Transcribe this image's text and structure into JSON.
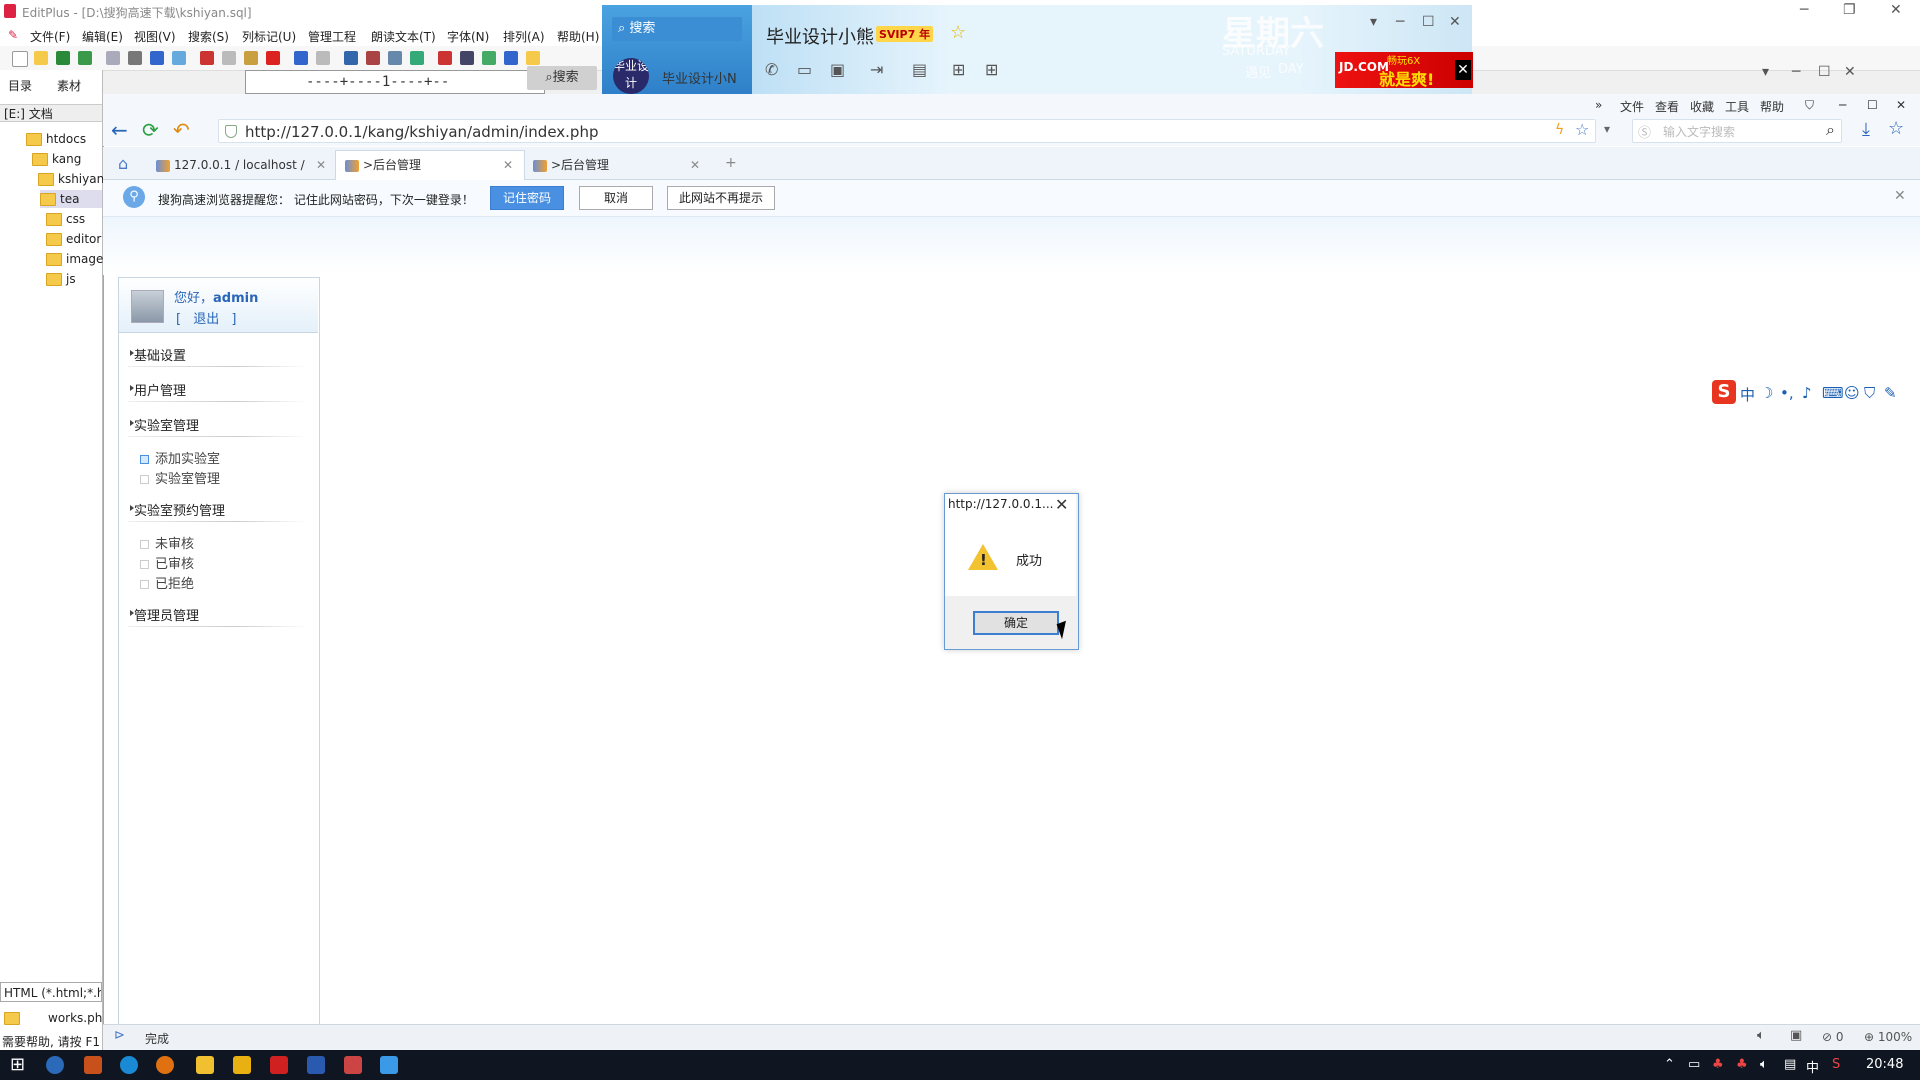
{
  "editplus": {
    "title": "EditPlus - [D:\\搜狗高速下载\\kshiyan.sql]",
    "menu": [
      "文件(F)",
      "编辑(E)",
      "视图(V)",
      "搜索(S)",
      "列标记(U)",
      "管理工程",
      "朗读文本(T)",
      "字体(N)",
      "排列(A)",
      "帮助(H)"
    ],
    "ruler": "----+----1----+--",
    "tabs": [
      "目录",
      "素材"
    ],
    "drive": "[E:] 文档",
    "tree": [
      "htdocs",
      "kang",
      "kshiyan",
      "tea",
      "css",
      "editor",
      "image",
      "js"
    ],
    "filter": "HTML (*.html;*.htm)",
    "file": "works.php",
    "help": "需要帮助, 请按 F1"
  },
  "qq": {
    "search_label": "搜索",
    "sub_search": "搜索",
    "avatar_text": "毕业设计",
    "friend": "毕业设计小N",
    "contact_name": "毕业设计小熊",
    "vip_badge": "SVIP7 年",
    "day_cn": "星期六",
    "day_en1": "SATURDAY",
    "day_en2": "DAY",
    "day_cn2": "遇见",
    "ad_logo": "JD.COM",
    "ad_small": "畅玩6X",
    "ad_big": "就是爽!"
  },
  "browser": {
    "menu": [
      "文件",
      "查看",
      "收藏",
      "工具",
      "帮助"
    ],
    "url": "http://127.0.0.1/kang/kshiyan/admin/index.php",
    "search_placeholder": "输入文字搜索",
    "tabs": [
      {
        "label": "127.0.0.1 / localhost /"
      },
      {
        "label": ">后台管理"
      },
      {
        "label": ">后台管理"
      }
    ],
    "notice": "搜狗高速浏览器提醒您：  记住此网站密码，下次一键登录！",
    "notice_buttons": [
      "记住密码",
      "取消",
      "此网站不再提示"
    ],
    "status": "完成",
    "zoom": "100%",
    "count": "0"
  },
  "sidebar": {
    "greeting": "您好，",
    "user": "admin",
    "logout": "[ 退出 ]",
    "sections": [
      {
        "label": "基础设置"
      },
      {
        "label": "用户管理"
      },
      {
        "label": "实验室管理",
        "items": [
          "添加实验室",
          "实验室管理"
        ]
      },
      {
        "label": "实验室预约管理",
        "items": [
          "未审核",
          "已审核",
          "已拒绝"
        ]
      },
      {
        "label": "管理员管理"
      }
    ]
  },
  "dialog": {
    "title": "http://127.0.0.1...",
    "message": "成功",
    "ok": "确定"
  },
  "ime": {
    "lang": "中"
  },
  "taskbar": {
    "time": "20:48",
    "ime": "中"
  }
}
